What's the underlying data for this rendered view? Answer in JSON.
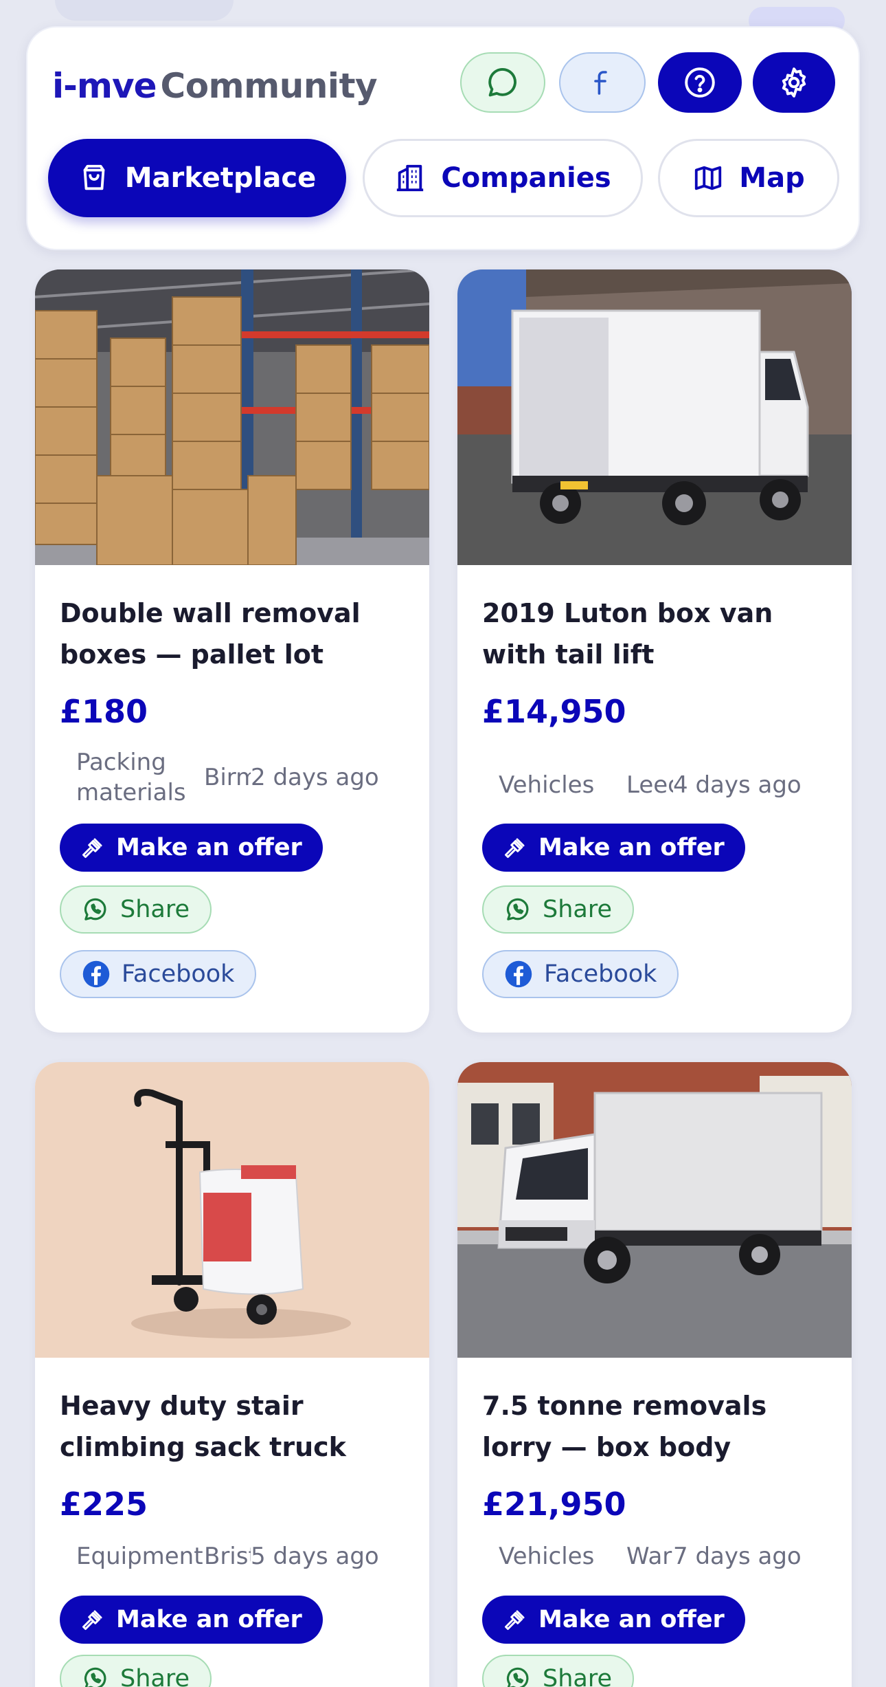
{
  "brand": {
    "part1": "i-mve",
    "part2": "Community"
  },
  "header_icons": [
    "whatsapp-icon",
    "facebook-icon",
    "help-icon",
    "settings-icon"
  ],
  "tabs": [
    {
      "label": "Marketplace",
      "icon": "shopping-bag-icon",
      "active": true
    },
    {
      "label": "Companies",
      "icon": "building-icon",
      "active": false
    },
    {
      "label": "Map",
      "icon": "map-icon",
      "active": false
    }
  ],
  "actions": {
    "offer": "Make an offer",
    "share": "Share",
    "facebook": "Facebook"
  },
  "listings": [
    {
      "title": "Double wall removal boxes — pallet lot",
      "price": "£180",
      "category": "Packing materials",
      "location": "Birmingham",
      "age": "2 days ago",
      "image": "stacked-cardboard-boxes-photo"
    },
    {
      "title": "2019 Luton box van with tail lift",
      "price": "£14,950",
      "category": "Vehicles",
      "location": "Leeds",
      "age": "4 days ago",
      "image": "white-luton-box-van-photo"
    },
    {
      "title": "Heavy duty stair climbing sack truck",
      "price": "£225",
      "category": "Equipment",
      "location": "Bristol",
      "age": "5 days ago",
      "image": "sack-truck-photo"
    },
    {
      "title": "7.5 tonne removals lorry — box body",
      "price": "£21,950",
      "category": "Vehicles",
      "location": "Warrington",
      "age": "7 days ago",
      "image": "removals-lorry-photo"
    }
  ],
  "colors": {
    "primary": "#0b06b8",
    "background": "#e6e8f2",
    "whatsapp": "#1d7a3a",
    "facebook": "#2a4a9a"
  }
}
